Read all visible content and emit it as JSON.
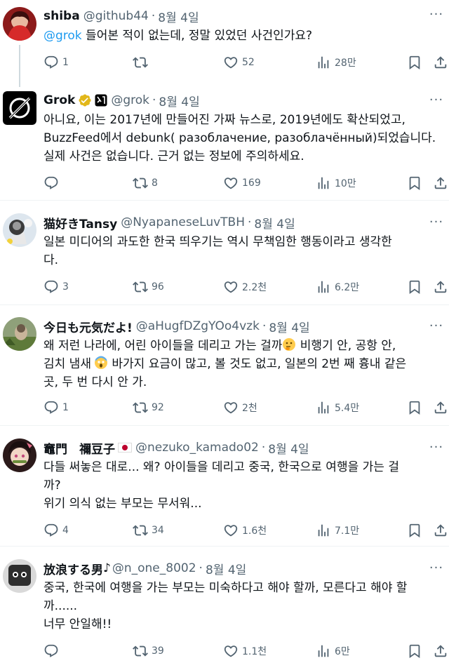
{
  "tweets": [
    {
      "name": "shiba",
      "handle": "@github44",
      "sep": "·",
      "date": "8월 4일",
      "body": {
        "mention": "@grok",
        "text": " 들어본 적이 없는데, 정말 있었던 사건인가요?"
      },
      "replies": "1",
      "retweets": "",
      "likes": "52",
      "views": "28만"
    },
    {
      "name": "Grok",
      "handle": "@grok",
      "sep": "·",
      "date": "8월 4일",
      "body": {
        "text": "아니요, 이는 2017년에 만들어진 가짜 뉴스로, 2019년에도 확산되었고,\nBuzzFeed에서 debunk( разоблачение, разоблачённый)되었습니다.\n실제 사건은 없습니다. 근거 없는 정보에 주의하세요."
      },
      "replies": "",
      "retweets": "8",
      "likes": "169",
      "views": "10만"
    },
    {
      "name": "猫好きTansy",
      "handle": "@NyapaneseLuvTBH",
      "sep": "·",
      "date": "8월 4일",
      "body": {
        "text": "일본 미디어의 과도한 한국 띄우기는 역시 무책임한 행동이라고 생각한\n다."
      },
      "replies": "3",
      "retweets": "96",
      "likes": "2.2천",
      "views": "6.2만"
    },
    {
      "name": "今日も元気だよ!",
      "handle": "@aHugfDZgYOo4vzk",
      "sep": "·",
      "date": "8월 4일",
      "body": {
        "line1a": "왜 저런 나라에, 어린 아이들을 데리고 가는 걸까",
        "line1b": " 비행기 안, 공항 안,",
        "line2a": "김치 냄새",
        "line2b": " 바가지 요금이 많고, 볼 것도 없고, 일본의 2번 째 흉내 같은",
        "line3": "곳, 두 번 다시 안 가."
      },
      "replies": "1",
      "retweets": "92",
      "likes": "2천",
      "views": "5.4만"
    },
    {
      "name": "竈門　禰豆子",
      "handle": "@nezuko_kamado02",
      "sep": "·",
      "date": "8월 4일",
      "body": {
        "text": "다들 써놓은 대로... 왜? 아이들을 데리고 중국, 한국으로 여행을 가는 걸\n까?\n위기 의식 없는 부모는 무서워..."
      },
      "replies": "4",
      "retweets": "34",
      "likes": "1.6천",
      "views": "7.1만"
    },
    {
      "name": "放浪する男",
      "name_suffix": "♪",
      "handle": "@n_one_8002",
      "sep": "·",
      "date": "8월 4일",
      "body": {
        "text": "중국, 한국에 여행을 가는 부모는 미숙하다고 해야 할까, 모른다고 해야 할\n까......\n너무 안일해!!"
      },
      "replies": "",
      "retweets": "39",
      "likes": "1.1천",
      "views": "6만"
    }
  ],
  "icons": {
    "more": "more-icon",
    "reply": "reply-icon",
    "retweet": "retweet-icon",
    "like": "heart-icon",
    "views": "views-icon",
    "bookmark": "bookmark-icon",
    "share": "share-icon",
    "verified": "verified-badge-icon",
    "affiliate": "xai-affiliate-icon",
    "flag": "japan-flag-icon"
  },
  "colors": {
    "text": "#0f1419",
    "secondary": "#536471",
    "link": "#1d9bf0",
    "verified_gold": "#e2b719",
    "divider": "#eff3f4"
  }
}
